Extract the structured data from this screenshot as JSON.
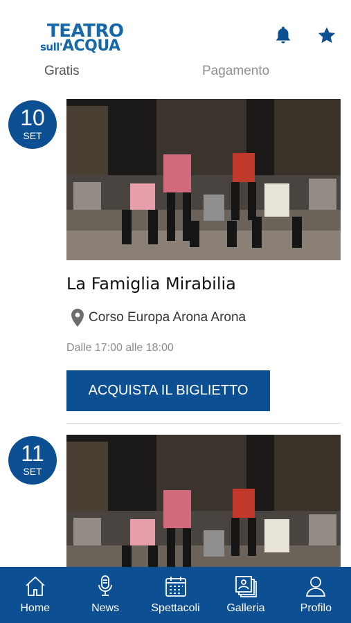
{
  "header": {
    "logo_line1": "TEATRO",
    "logo_line2_prefix": "sull'",
    "logo_line2": "ACQUA",
    "icons": [
      "bell-icon",
      "star-icon"
    ],
    "filters": {
      "free": "Gratis",
      "paid": "Pagamento"
    }
  },
  "events": [
    {
      "day": "10",
      "month": "SET",
      "title": "La Famiglia Mirabilia",
      "location": "Corso Europa Arona Arona",
      "time": "Dalle 17:00 alle 18:00",
      "button": "ACQUISTA IL BIGLIETTO"
    },
    {
      "day": "11",
      "month": "SET"
    }
  ],
  "tabbar": {
    "items": [
      {
        "label": "Home",
        "icon": "home-icon"
      },
      {
        "label": "News",
        "icon": "microphone-icon"
      },
      {
        "label": "Spettacoli",
        "icon": "calendar-icon"
      },
      {
        "label": "Galleria",
        "icon": "gallery-icon"
      },
      {
        "label": "Profilo",
        "icon": "profile-icon"
      }
    ]
  },
  "colors": {
    "primary": "#0d4f93",
    "logo": "#1668a8"
  }
}
